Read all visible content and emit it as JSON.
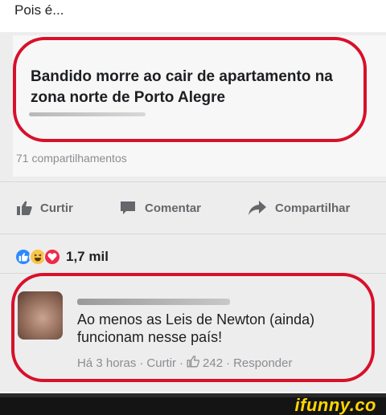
{
  "caption": "Pois é...",
  "post": {
    "headline": "Bandido morre ao cair de apartamento na zona norte de Porto Alegre",
    "shares": "71 compartilhamentos"
  },
  "actions": {
    "like": "Curtir",
    "comment": "Comentar",
    "share": "Compartilhar"
  },
  "reactions": {
    "types": [
      "like",
      "haha",
      "love"
    ],
    "count": "1,7 mil"
  },
  "comment": {
    "text": "Ao menos as Leis de Newton (ainda) funcionam nesse país!",
    "time": "Há 3 horas",
    "like": "Curtir",
    "likes": "242",
    "reply": "Responder",
    "separator": "·"
  },
  "footer": {
    "brand": "ifunny.co"
  },
  "colors": {
    "highlight": "#d8102a",
    "brand": "#ffd500",
    "like_reaction": "#2d88ff",
    "love_reaction": "#f02849",
    "haha_reaction": "#f7c64a"
  }
}
